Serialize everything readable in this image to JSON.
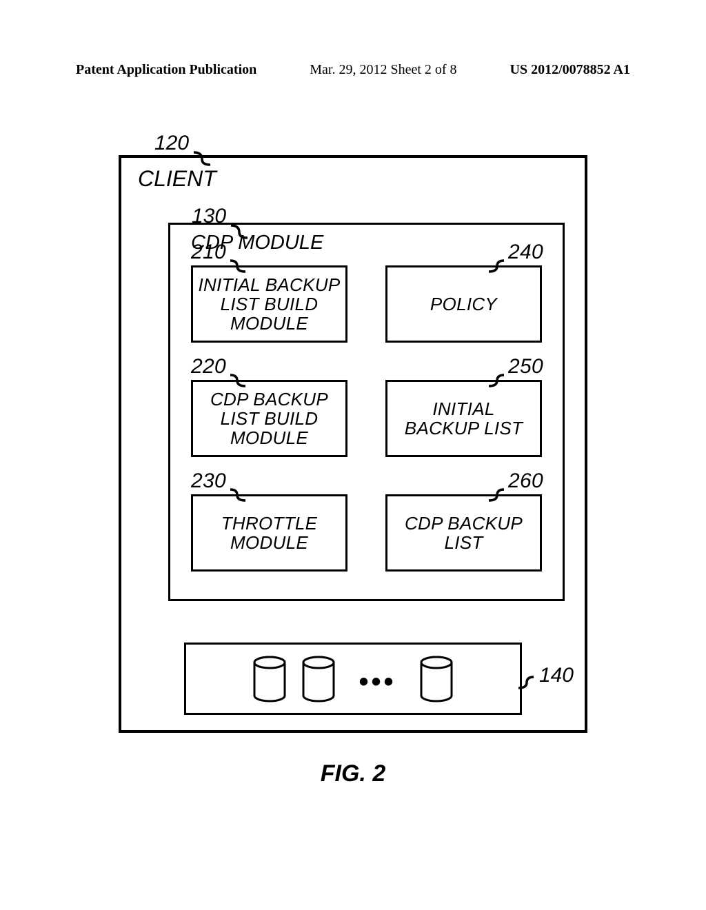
{
  "header": {
    "left": "Patent Application Publication",
    "mid": "Mar. 29, 2012  Sheet 2 of 8",
    "right": "US 2012/0078852 A1"
  },
  "refs": {
    "client": "120",
    "cdp": "130",
    "r1l": "210",
    "r1r": "240",
    "r2l": "220",
    "r2r": "250",
    "r3l": "230",
    "r3r": "260",
    "storage": "140"
  },
  "labels": {
    "client": "CLIENT",
    "cdp": "CDP MODULE",
    "b210": "INITIAL BACKUP\nLIST BUILD\nMODULE",
    "b240": "POLICY",
    "b220": "CDP BACKUP\nLIST BUILD\nMODULE",
    "b250": "INITIAL\nBACKUP LIST",
    "b230": "THROTTLE\nMODULE",
    "b260": "CDP BACKUP\nLIST"
  },
  "caption": "FIG. 2"
}
